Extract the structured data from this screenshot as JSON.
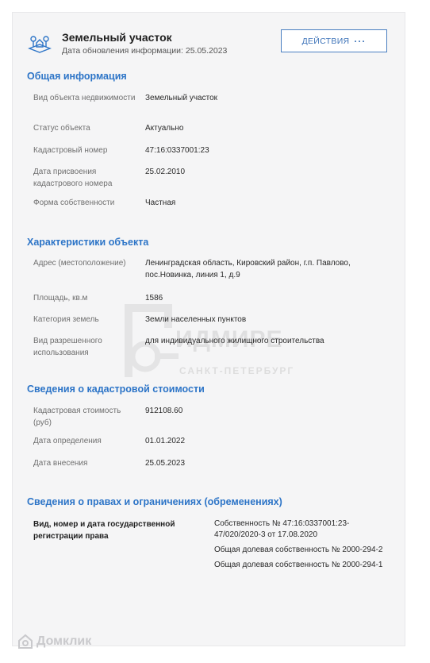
{
  "header": {
    "icon": "land-plot-icon",
    "title": "Земельный участок",
    "update_label": "Дата обновления информации: 25.05.2023",
    "actions_label": "ДЕЙСТВИЯ",
    "actions_dots": "···"
  },
  "general": {
    "title": "Общая информация",
    "rows": [
      {
        "k": "Вид объекта недвижимости",
        "v": "Земельный участок"
      },
      {
        "k": "Статус объекта",
        "v": "Актуально"
      },
      {
        "k": "Кадастровый номер",
        "v": "47:16:0337001:23"
      },
      {
        "k": "Дата присвоения кадастрового номера",
        "v": "25.02.2010"
      },
      {
        "k": "Форма собственности",
        "v": "Частная"
      }
    ]
  },
  "characteristics": {
    "title": "Характеристики объекта",
    "rows": [
      {
        "k": "Адрес (местоположение)",
        "v": "Ленинградская область, Кировский район, г.п. Павлово, пос.Новинка, линия 1, д.9"
      },
      {
        "k": "Площадь, кв.м",
        "v": "1586"
      },
      {
        "k": "Категория земель",
        "v": "Земли населенных пунктов"
      },
      {
        "k": "Вид разрешенного использования",
        "v": "для индивидуального жилищного строительства"
      }
    ]
  },
  "cadastral": {
    "title": "Сведения о кадастровой стоимости",
    "rows": [
      {
        "k": "Кадастровая стоимость (руб)",
        "v": "912108.60"
      },
      {
        "k": "Дата определения",
        "v": "01.01.2022"
      },
      {
        "k": "Дата внесения",
        "v": "25.05.2023"
      }
    ]
  },
  "rights": {
    "title": "Сведения о правах и ограничениях (обременениях)",
    "key": "Вид, номер и дата государственной регистрации права",
    "entries": [
      "Собственность № 47:16:0337001:23-47/020/2020-3 от 17.08.2020",
      "Общая долевая собственность № 2000-294-2",
      "Общая долевая собственность № 2000-294-1"
    ]
  },
  "watermark": {
    "text": "ИДМИРЕ",
    "sub": "САНКТ-ПЕТЕРБУРГ"
  },
  "footer": {
    "brand": "Домклик"
  }
}
